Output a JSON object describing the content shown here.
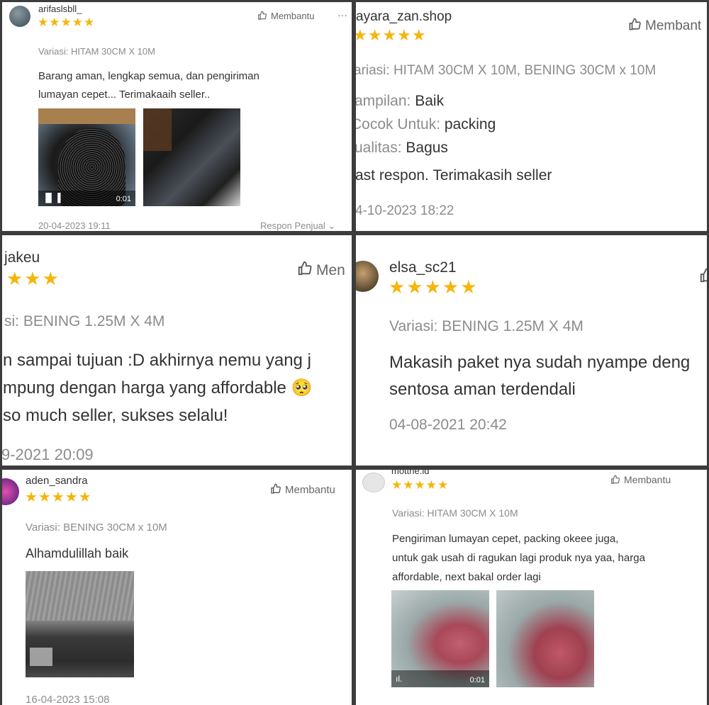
{
  "reviews": [
    {
      "username": "arifaslsbll_",
      "stars": "★★★★★",
      "helpful": "Membantu",
      "menu": "···",
      "variation": "Variasi: HITAM 30CM X 10M",
      "text_lines": [
        "Barang aman, lengkap semua, dan pengiriman",
        "lumayan cepet... Terimakaaih seller.."
      ],
      "video_duration": "0:01",
      "date": "20-04-2023 19:11",
      "seller_response": "Respon Penjual"
    },
    {
      "username": "ayara_zan.shop",
      "stars": "★★★★★",
      "helpful": "Membant",
      "variation": "ariasi: HITAM 30CM X 10M, BENING 30CM x 10M",
      "attr1_label": "ampilan:",
      "attr1_value": "Baik",
      "attr2_label": "Cocok Untuk:",
      "attr2_value": "packing",
      "attr3_label": "ualitas:",
      "attr3_value": "Bagus",
      "text_lines": [
        "ast respon. Terimakasih seller"
      ],
      "date": "4-10-2023 18:22"
    },
    {
      "username": "jakeu",
      "stars": "★★★",
      "helpful": "Men",
      "variation": "si: BENING 1.25M X 4M",
      "text_lines": [
        "n sampai tujuan :D akhirnya nemu yang j",
        "mpung dengan harga yang affordable 🥺",
        "so much seller, sukses selalu!"
      ],
      "date": "9-2021 20:09"
    },
    {
      "username": "elsa_sc21",
      "stars": "★★★★★",
      "variation": "Variasi: BENING 1.25M X 4M",
      "text_lines": [
        "Makasih paket nya sudah nyampe deng",
        "sentosa aman terdendali"
      ],
      "date": "04-08-2021 20:42"
    },
    {
      "username": "aden_sandra",
      "stars": "★★★★★",
      "helpful": "Membantu",
      "variation": "Variasi: BENING 30CM x 10M",
      "text_lines": [
        "Alhamdulillah baik"
      ],
      "date": "16-04-2023 15:08"
    },
    {
      "username": "mottne.id",
      "stars": "★★★★★",
      "helpful": "Membantu",
      "variation": "Variasi: HITAM 30CM X 10M",
      "text_lines": [
        "Pengiriman lumayan cepet, packing okeee juga,",
        "untuk gak usah di ragukan lagi produk nya yaa, harga",
        "affordable, next bakal order lagi"
      ],
      "video_duration": "0:01"
    }
  ],
  "colors": {
    "star": "#f5b50a",
    "grey_text": "#8c8c8c",
    "separator": "#3c3c3c"
  },
  "icons": [
    "thumbs-up-icon",
    "more-icon",
    "play-icon",
    "chevron-down-icon",
    "avatar"
  ]
}
